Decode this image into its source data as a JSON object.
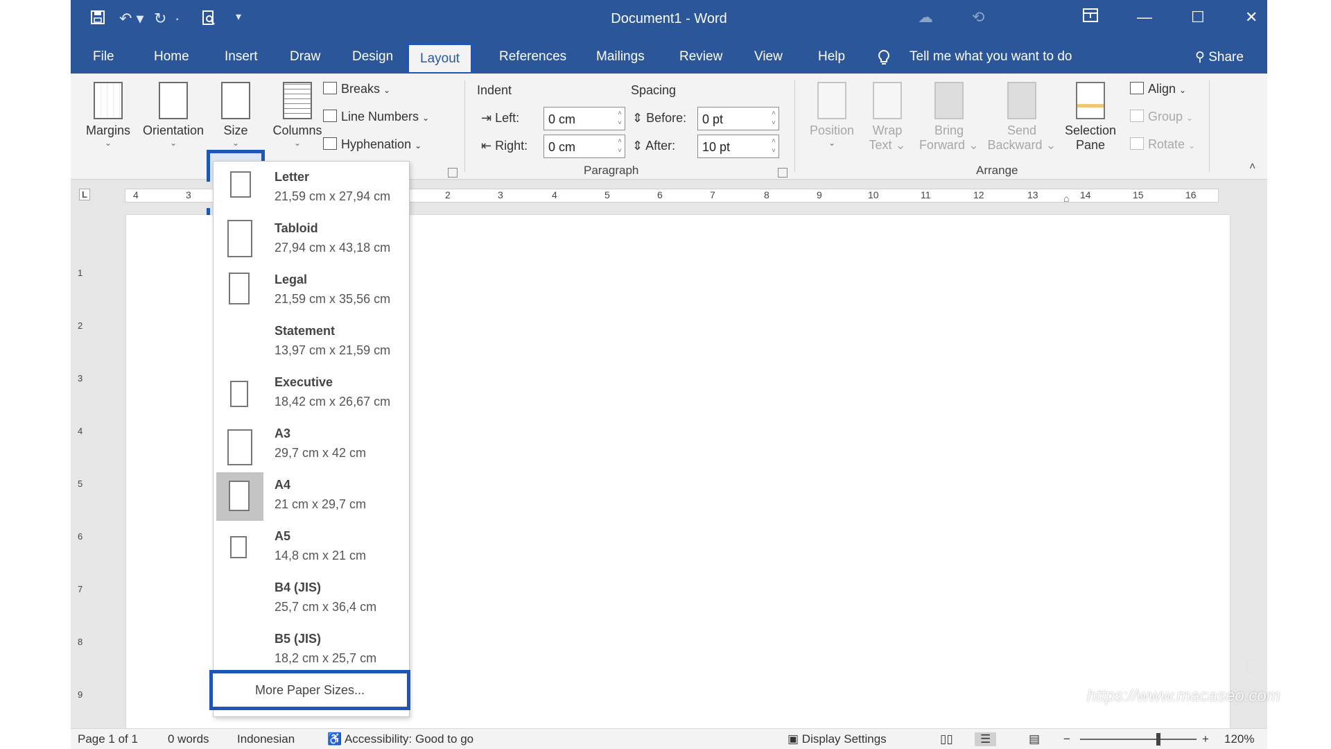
{
  "window": {
    "title": "Document1  -  Word",
    "controls": {
      "minimize": "—",
      "maximize": "☐",
      "close": "✕"
    }
  },
  "quick_access": {
    "save_icon": "save-icon",
    "undo_icon": "undo-icon",
    "redo_icon": "redo-icon",
    "customize": "▾"
  },
  "tabs": [
    {
      "label": "File"
    },
    {
      "label": "Home"
    },
    {
      "label": "Insert"
    },
    {
      "label": "Draw"
    },
    {
      "label": "Design"
    },
    {
      "label": "Layout"
    },
    {
      "label": "References"
    },
    {
      "label": "Mailings"
    },
    {
      "label": "Review"
    },
    {
      "label": "View"
    },
    {
      "label": "Help"
    }
  ],
  "active_tab": "Layout",
  "tell_me": "Tell me what you want to do",
  "share": "Share",
  "ribbon": {
    "page_setup": {
      "margins": "Margins",
      "orientation": "Orientation",
      "size": "Size",
      "columns": "Columns",
      "breaks": "Breaks",
      "line_numbers": "Line Numbers",
      "hyphenation": "Hyphenation"
    },
    "paragraph": {
      "group_label": "Paragraph",
      "indent_title": "Indent",
      "spacing_title": "Spacing",
      "left_label": "Left:",
      "left_value": "0 cm",
      "right_label": "Right:",
      "right_value": "0 cm",
      "before_label": "Before:",
      "before_value": "0 pt",
      "after_label": "After:",
      "after_value": "10 pt"
    },
    "arrange": {
      "group_label": "Arrange",
      "position": "Position",
      "wrap_text_1": "Wrap",
      "wrap_text_2": "Text",
      "bring_forward_1": "Bring",
      "bring_forward_2": "Forward",
      "send_backward_1": "Send",
      "send_backward_2": "Backward",
      "selection_pane_1": "Selection",
      "selection_pane_2": "Pane",
      "align": "Align",
      "group": "Group",
      "rotate": "Rotate"
    }
  },
  "ruler": {
    "corner": "L",
    "h_ticks": [
      "4",
      "3",
      "2",
      "3",
      "4",
      "5",
      "6",
      "7",
      "8",
      "9",
      "10",
      "11",
      "12",
      "13",
      "14",
      "15",
      "16"
    ],
    "v_ticks": [
      "1",
      "2",
      "3",
      "4",
      "5",
      "6",
      "7",
      "8",
      "9"
    ]
  },
  "size_menu": {
    "items": [
      {
        "name": "Letter",
        "dims": "21,59 cm x 27,94 cm"
      },
      {
        "name": "Tabloid",
        "dims": "27,94 cm x 43,18 cm"
      },
      {
        "name": "Legal",
        "dims": "21,59 cm x 35,56 cm"
      },
      {
        "name": "Statement",
        "dims": "13,97 cm x 21,59 cm"
      },
      {
        "name": "Executive",
        "dims": "18,42 cm x 26,67 cm"
      },
      {
        "name": "A3",
        "dims": "29,7 cm x 42 cm"
      },
      {
        "name": "A4",
        "dims": "21 cm x 29,7 cm"
      },
      {
        "name": "A5",
        "dims": "14,8 cm x 21 cm"
      },
      {
        "name": "B4 (JIS)",
        "dims": "25,7 cm x 36,4 cm"
      },
      {
        "name": "B5 (JIS)",
        "dims": "18,2 cm x 25,7 cm"
      }
    ],
    "selected": "A4",
    "more": "More Paper Sizes..."
  },
  "status_bar": {
    "page": "Page 1 of 1",
    "words": "0 words",
    "language": "Indonesian",
    "accessibility": "Accessibility: Good to go",
    "display_settings": "Display Settings",
    "zoom_minus": "−",
    "zoom_plus": "+",
    "zoom": "120%",
    "zoom_level_percent": 120
  },
  "watermark": "https://www.macaseo.com"
}
